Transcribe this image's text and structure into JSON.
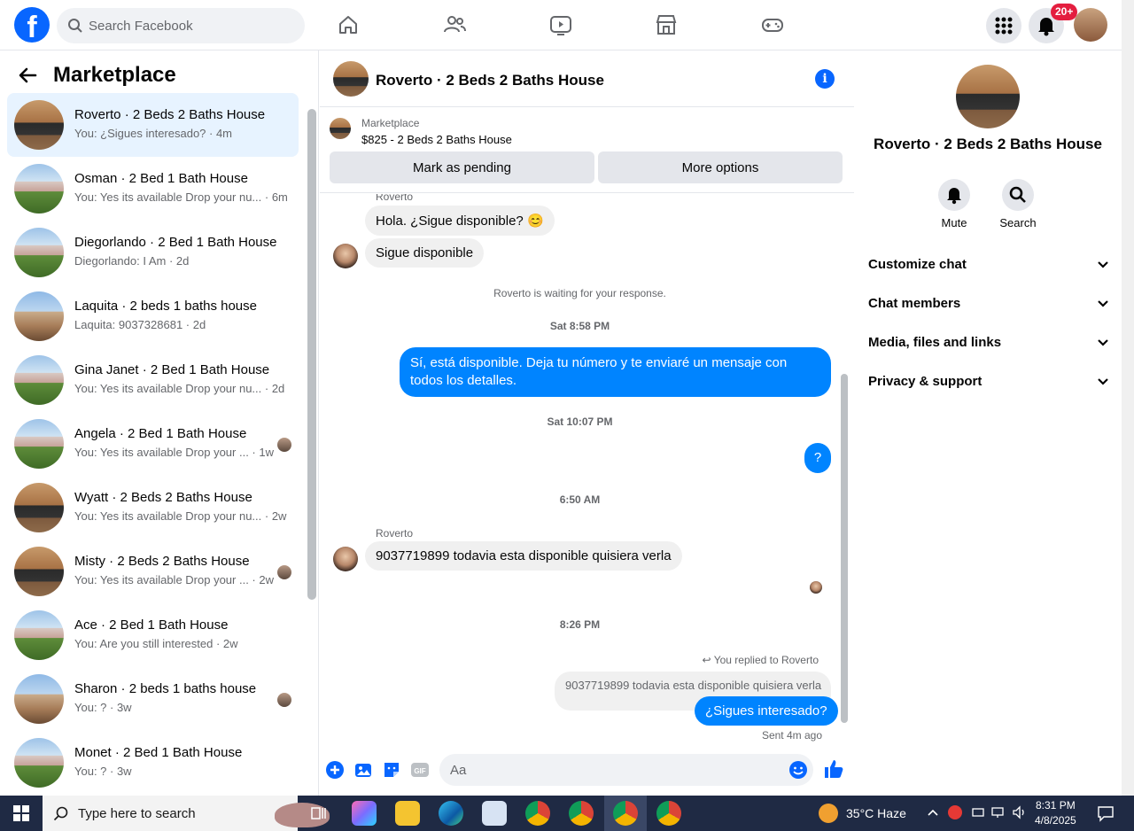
{
  "topbar": {
    "logo_letter": "f",
    "search_placeholder": "Search Facebook",
    "notifications_badge": "20+"
  },
  "sidebar": {
    "title": "Marketplace",
    "conversations": [
      {
        "name": "Roverto · 2 Beds 2 Baths House",
        "preview": "You: ¿Sigues interesado? · 4m",
        "thumb": "kitchen",
        "active": true
      },
      {
        "name": "Osman · 2 Bed 1 Bath House",
        "preview": "You: Yes its available Drop your nu... · 6m",
        "thumb": "house"
      },
      {
        "name": "Diegorlando · 2 Bed 1 Bath House",
        "preview": "Diegorlando: I Am · 2d",
        "thumb": "house"
      },
      {
        "name": "Laquita · 2 beds 1 baths house",
        "preview": "Laquita: 9037328681 · 2d",
        "thumb": "adobe"
      },
      {
        "name": "Gina Janet · 2 Bed 1 Bath House",
        "preview": "You: Yes its available Drop your nu... · 2d",
        "thumb": "house"
      },
      {
        "name": "Angela · 2 Bed 1 Bath House",
        "preview": "You: Yes its available Drop your ... · 1w",
        "thumb": "house",
        "seen": true
      },
      {
        "name": "Wyatt · 2 Beds 2 Baths House",
        "preview": "You: Yes its available Drop your nu... · 2w",
        "thumb": "kitchen"
      },
      {
        "name": "Misty · 2 Beds 2 Baths House",
        "preview": "You: Yes its available Drop your ... · 2w",
        "thumb": "kitchen",
        "seen": true
      },
      {
        "name": "Ace · 2 Bed 1 Bath House",
        "preview": "You: Are you still interested · 2w",
        "thumb": "house"
      },
      {
        "name": "Sharon · 2 beds 1 baths house",
        "preview": "You: ? · 3w",
        "thumb": "adobe",
        "seen": true
      },
      {
        "name": "Monet · 2 Bed 1 Bath House",
        "preview": "You: ? · 3w",
        "thumb": "house"
      }
    ]
  },
  "chat": {
    "title": "Roverto · 2 Beds 2 Baths House",
    "listing_source": "Marketplace",
    "listing_price": "$825 - 2 Beds 2 Baths House",
    "mark_pending": "Mark as pending",
    "more_options": "More options",
    "sender_top": "Roverto",
    "msg1": "Hola. ¿Sigue disponible? 😊",
    "msg2": "Sigue disponible",
    "waiting": "Roverto is waiting for your response.",
    "time1": "Sat 8:58 PM",
    "out1": "Sí, está disponible. Deja tu número y te enviaré un mensaje con todos los detalles.",
    "time2": "Sat 10:07 PM",
    "out2": "?",
    "time3": "6:50 AM",
    "sender_mid": "Roverto",
    "msg3": "9037719899 todavia esta disponible  quisiera verla",
    "time4": "8:26 PM",
    "replied_to": "You replied to Roverto",
    "quoted": "9037719899 todavia esta disponible  quisiera verla",
    "out3": "¿Sigues interesado?",
    "sent_status": "Sent 4m ago",
    "composer_placeholder": "Aa"
  },
  "details": {
    "title": "Roverto · 2 Beds 2 Baths House",
    "mute_label": "Mute",
    "search_label": "Search",
    "sections": [
      "Customize chat",
      "Chat members",
      "Media, files and links",
      "Privacy & support"
    ]
  },
  "taskbar": {
    "search_placeholder": "Type here to search",
    "weather": "35°C  Haze",
    "time": "8:31 PM",
    "date": "4/8/2025"
  },
  "colors": {
    "accent": "#0866ff",
    "bubble_out": "#0084ff",
    "active_row": "#e7f3ff"
  }
}
